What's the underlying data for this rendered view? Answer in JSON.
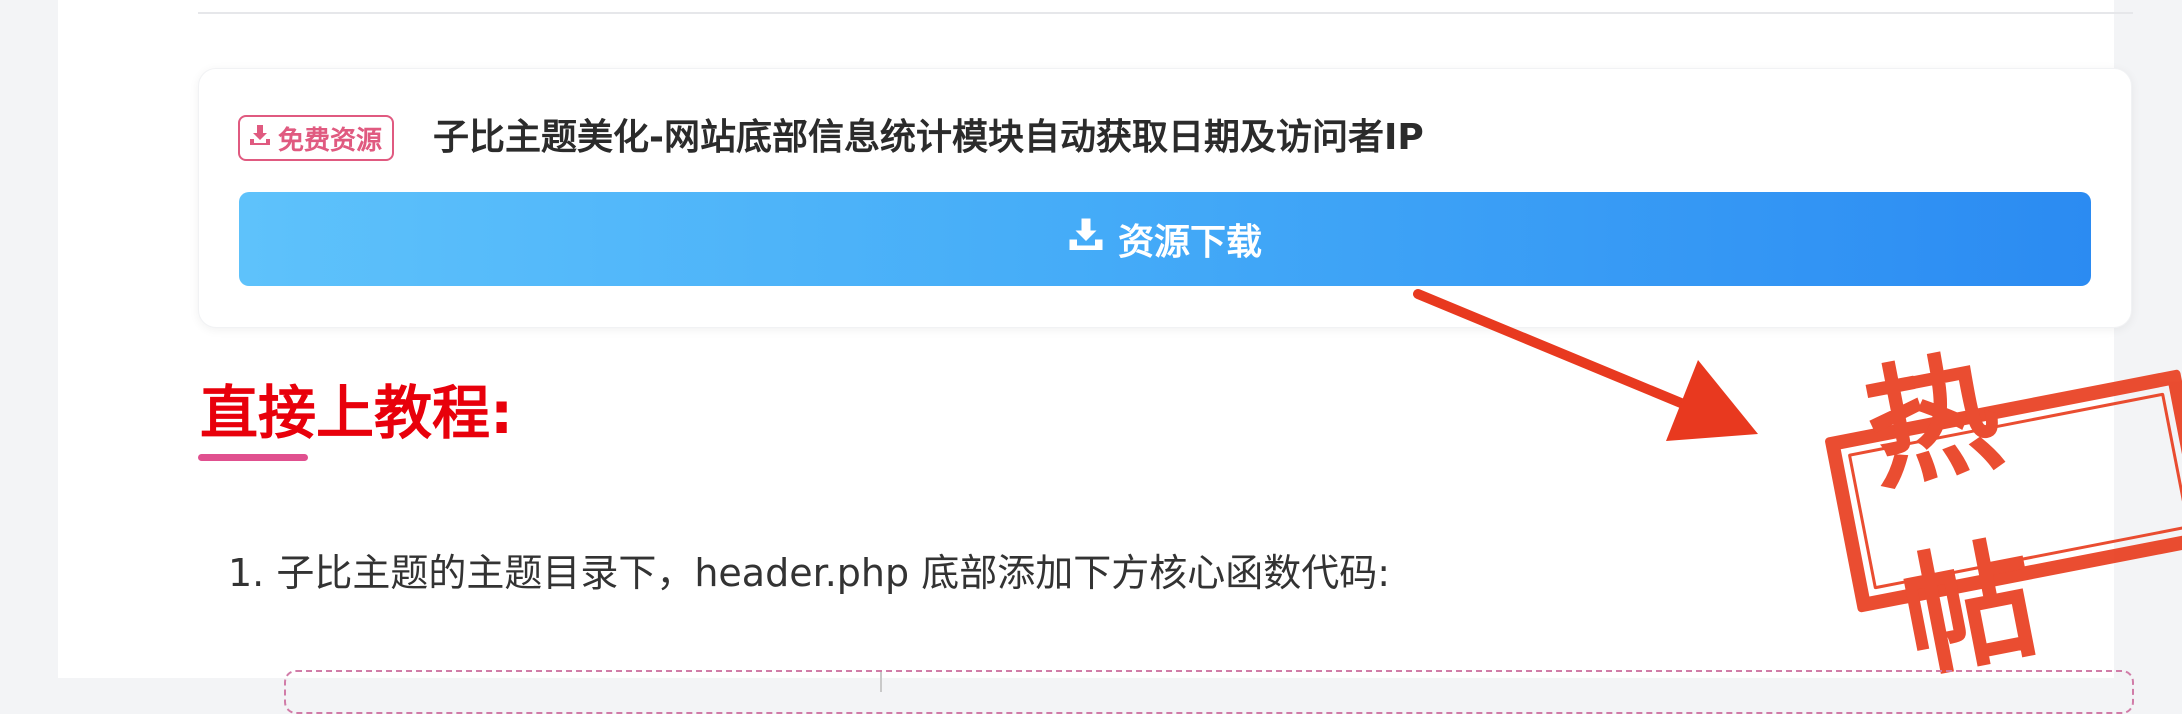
{
  "resource": {
    "badge_label": "免费资源",
    "title": "子比主题美化-网站底部信息统计模块自动获取日期及访问者IP",
    "download_label": "资源下载"
  },
  "content": {
    "heading": "直接上教程:",
    "step_1": "1. 子比主题的主题目录下，header.php 底部添加下方核心函数代码:"
  },
  "stamp": {
    "text": "热帖"
  },
  "colors": {
    "badge": "#e05a80",
    "button_start": "#5ec2fb",
    "button_end": "#2b8bf2",
    "heading": "#e8000b",
    "arrow": "#e8391f",
    "stamp": "#e94426"
  },
  "icons": {
    "download": "download-icon",
    "arrow": "pointer-arrow"
  }
}
